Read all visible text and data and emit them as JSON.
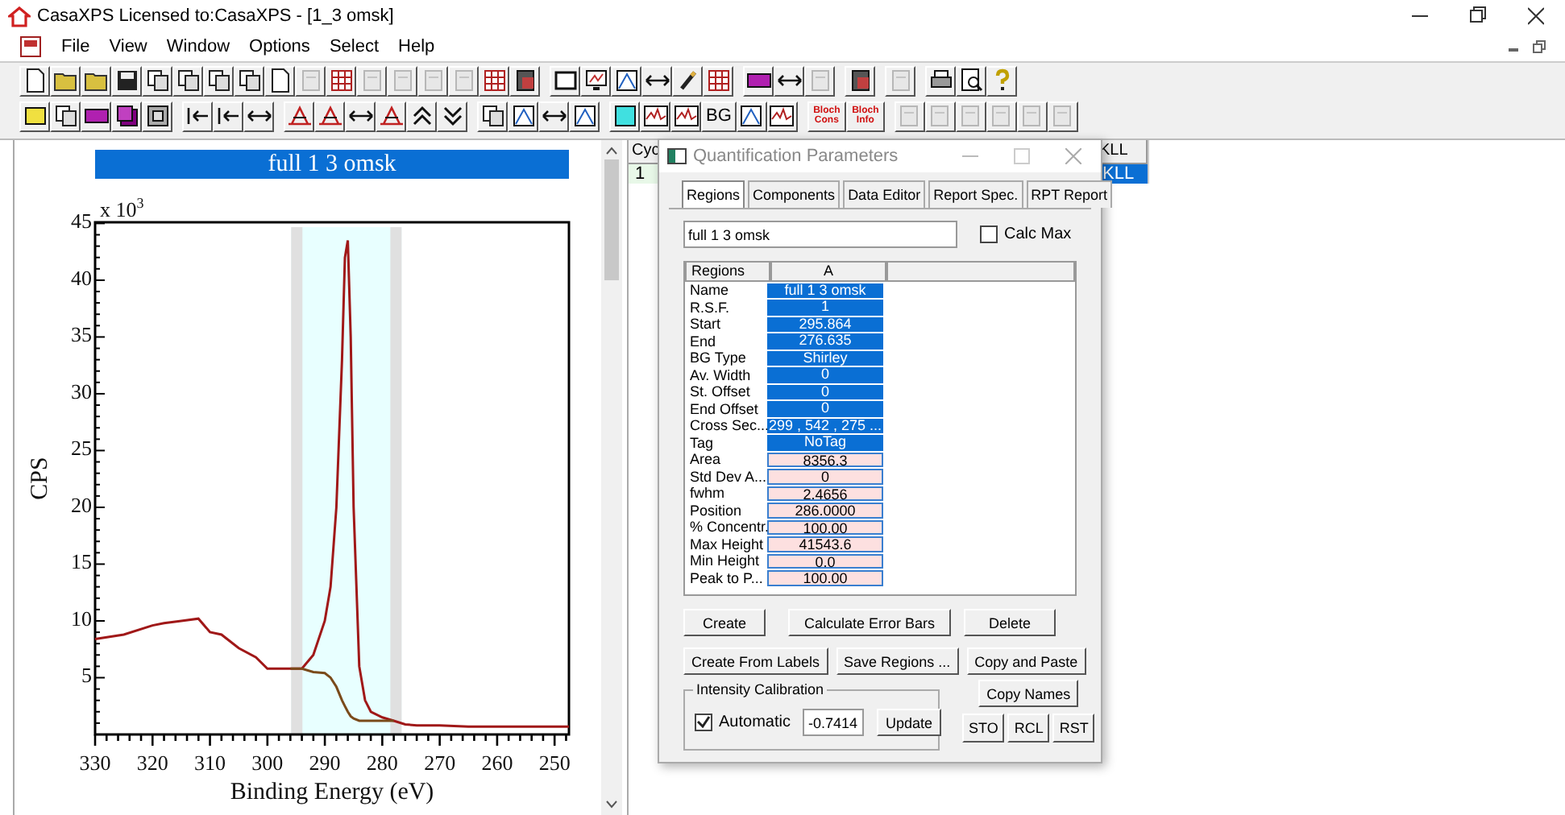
{
  "window": {
    "title": "CasaXPS Licensed to:CasaXPS - [1_3 omsk]"
  },
  "menu": [
    "File",
    "View",
    "Window",
    "Options",
    "Select",
    "Help"
  ],
  "toolbar_2_labels": [
    {
      "label": "BG",
      "kind": "plain"
    },
    {
      "label": "Bloch Cons",
      "kind": "red"
    },
    {
      "label": "Bloch Info",
      "kind": "red"
    }
  ],
  "spectrum": {
    "chart_data": {
      "type": "line",
      "title": "full 1 3 omsk",
      "xlabel": "Binding Energy (eV)",
      "ylabel": "CPS",
      "xlim": [
        330,
        247.5
      ],
      "ylim": [
        0,
        45.1
      ],
      "xticks": [
        330,
        320,
        310,
        300,
        290,
        280,
        270,
        260,
        250
      ],
      "yticks": [
        5,
        10,
        15,
        20,
        25,
        30,
        35,
        40,
        45
      ],
      "x": [
        330,
        325,
        320,
        318,
        315,
        312,
        310,
        308,
        305,
        302,
        300,
        298,
        296,
        294,
        292,
        290,
        289,
        288,
        287,
        286.5,
        286,
        285.5,
        285,
        284,
        283,
        282,
        280,
        278,
        276,
        274,
        270,
        265,
        260,
        255,
        250,
        247.5
      ],
      "series": [
        {
          "color": "#a01818",
          "values": [
            8.4,
            8.8,
            9.6,
            9.8,
            10,
            10.2,
            9.0,
            8.8,
            7.6,
            6.8,
            5.8,
            5.8,
            5.8,
            5.8,
            7,
            10,
            13,
            20,
            33,
            42,
            43.5,
            35,
            20,
            6,
            3,
            2,
            1.5,
            1.2,
            0.9,
            0.8,
            0.8,
            0.7,
            0.7,
            0.7,
            0.7,
            0.7
          ]
        },
        {
          "color": "#7a4a1a",
          "values": [
            null,
            null,
            null,
            null,
            null,
            null,
            null,
            null,
            null,
            null,
            null,
            null,
            5.8,
            5.8,
            5.5,
            5.4,
            5.0,
            4.2,
            3.0,
            2.5,
            2.0,
            1.6,
            1.4,
            1.2,
            1.2,
            1.2,
            1.2,
            1.2,
            null,
            null,
            null,
            null,
            null,
            null,
            null,
            null
          ]
        }
      ],
      "annotations": [
        "x 10$^{3}$"
      ]
    }
  },
  "table": {
    "columns": [
      {
        "header": "Cyc",
        "cells": [
          {
            "text": "1",
            "selected": false
          }
        ]
      },
      {
        "header": "KLL",
        "cells": [
          {
            "text": "KLL",
            "selected": true
          }
        ]
      }
    ]
  },
  "dialog": {
    "title": "Quantification Parameters",
    "tabs": [
      {
        "label": "Regions",
        "selected": true
      },
      {
        "label": "Components",
        "selected": false
      },
      {
        "label": "Data Editor",
        "selected": false
      },
      {
        "label": "Report Spec.",
        "selected": false
      },
      {
        "label": "RPT Report",
        "selected": false
      }
    ],
    "name_field": {
      "value": "full 1 3 omsk"
    },
    "calc_max": {
      "label": "Calc Max",
      "checked": false
    },
    "grid": {
      "columns": [
        "Regions",
        "A"
      ],
      "rows": [
        {
          "label": "Name",
          "value": "full 1 3 omsk",
          "kind": "parameter"
        },
        {
          "label": "R.S.F.",
          "value": "1",
          "kind": "parameter"
        },
        {
          "label": "Start",
          "value": "295.864",
          "kind": "parameter"
        },
        {
          "label": "End",
          "value": "276.635",
          "kind": "parameter"
        },
        {
          "label": "BG Type",
          "value": "Shirley",
          "kind": "parameter"
        },
        {
          "label": "Av. Width",
          "value": "0",
          "kind": "parameter"
        },
        {
          "label": "St. Offset",
          "value": "0",
          "kind": "parameter"
        },
        {
          "label": "End Offset",
          "value": "0",
          "kind": "parameter"
        },
        {
          "label": "Cross Sec...",
          "value": "299 , 542 , 275 ...",
          "kind": "parameter"
        },
        {
          "label": "Tag",
          "value": "NoTag",
          "kind": "parameter"
        },
        {
          "label": "Area",
          "value": "8356.3",
          "kind": "result"
        },
        {
          "label": "Std Dev A...",
          "value": "0",
          "kind": "result"
        },
        {
          "label": "fwhm",
          "value": "2.4656",
          "kind": "result"
        },
        {
          "label": "Position",
          "value": "286.0000",
          "kind": "result"
        },
        {
          "label": "% Concentr.",
          "value": "100.00",
          "kind": "result"
        },
        {
          "label": "Max Height",
          "value": "41543.6",
          "kind": "result"
        },
        {
          "label": "Min Height",
          "value": "0.0",
          "kind": "result"
        },
        {
          "label": "Peak to P...",
          "value": "100.00",
          "kind": "result"
        }
      ]
    },
    "buttons_row_1": [
      "Create",
      "Calculate Error Bars",
      "Delete"
    ],
    "buttons_row_2": [
      "Create From Labels",
      "Save Regions ...",
      "Copy and Paste"
    ],
    "intensity_calibration": {
      "title": "Intensity Calibration",
      "automatic": {
        "label": "Automatic",
        "checked": true
      },
      "value": "-0.7414",
      "button": "Update"
    },
    "copy_names": "Copy Names",
    "small_buttons": [
      "STO",
      "RCL",
      "RST"
    ]
  }
}
